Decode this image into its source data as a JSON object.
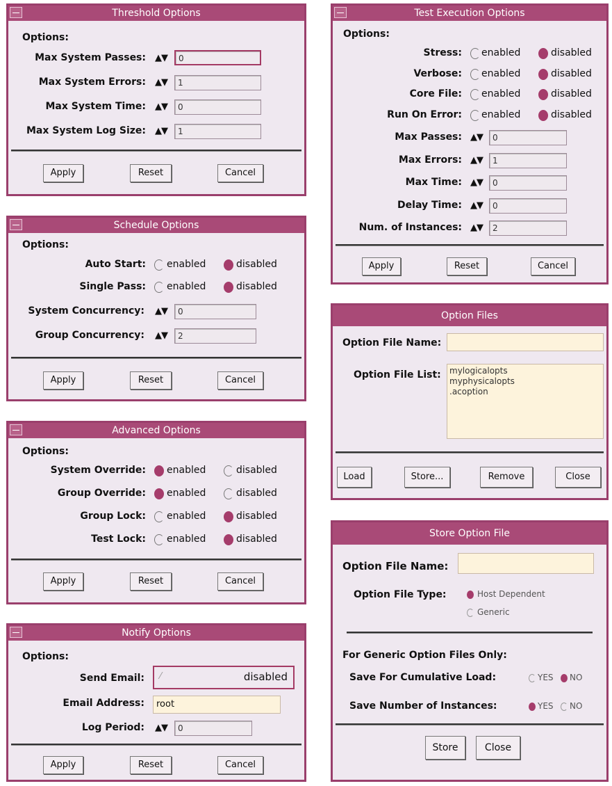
{
  "threshold": {
    "title": "Threshold Options",
    "options_label": "Options:",
    "fields": [
      {
        "label": "Max System Passes:",
        "value": "0"
      },
      {
        "label": "Max System Errors:",
        "value": "1"
      },
      {
        "label": "Max System Time:",
        "value": "0"
      },
      {
        "label": "Max System Log Size:",
        "value": "1"
      }
    ],
    "buttons": {
      "apply": "Apply",
      "reset": "Reset",
      "cancel": "Cancel"
    }
  },
  "schedule": {
    "title": "Schedule Options",
    "options_label": "Options:",
    "radios": [
      {
        "label": "Auto Start:",
        "enabled": "enabled",
        "disabled": "disabled",
        "selected": "disabled"
      },
      {
        "label": "Single Pass:",
        "enabled": "enabled",
        "disabled": "disabled",
        "selected": "disabled"
      }
    ],
    "fields": [
      {
        "label": "System Concurrency:",
        "value": "0"
      },
      {
        "label": "Group Concurrency:",
        "value": "2"
      }
    ],
    "buttons": {
      "apply": "Apply",
      "reset": "Reset",
      "cancel": "Cancel"
    }
  },
  "advanced": {
    "title": "Advanced Options",
    "options_label": "Options:",
    "radios": [
      {
        "label": "System Override:",
        "enabled": "enabled",
        "disabled": "disabled",
        "selected": "enabled"
      },
      {
        "label": "Group Override:",
        "enabled": "enabled",
        "disabled": "disabled",
        "selected": "enabled"
      },
      {
        "label": "Group Lock:",
        "enabled": "enabled",
        "disabled": "disabled",
        "selected": "disabled"
      },
      {
        "label": "Test Lock:",
        "enabled": "enabled",
        "disabled": "disabled",
        "selected": "disabled"
      }
    ],
    "buttons": {
      "apply": "Apply",
      "reset": "Reset",
      "cancel": "Cancel"
    }
  },
  "notify": {
    "title": "Notify Options",
    "options_label": "Options:",
    "send_email_label": "Send Email:",
    "send_email_value": "disabled",
    "email_label": "Email Address:",
    "email_value": "root",
    "log_period_label": "Log Period:",
    "log_period_value": "0",
    "buttons": {
      "apply": "Apply",
      "reset": "Reset",
      "cancel": "Cancel"
    }
  },
  "test_exec": {
    "title": "Test Execution Options",
    "options_label": "Options:",
    "radios": [
      {
        "label": "Stress:",
        "enabled": "enabled",
        "disabled": "disabled",
        "selected": "disabled"
      },
      {
        "label": "Verbose:",
        "enabled": "enabled",
        "disabled": "disabled",
        "selected": "disabled"
      },
      {
        "label": "Core File:",
        "enabled": "enabled",
        "disabled": "disabled",
        "selected": "disabled"
      },
      {
        "label": "Run On Error:",
        "enabled": "enabled",
        "disabled": "disabled",
        "selected": "disabled"
      }
    ],
    "fields": [
      {
        "label": "Max Passes:",
        "value": "0"
      },
      {
        "label": "Max Errors:",
        "value": "1"
      },
      {
        "label": "Max Time:",
        "value": "0"
      },
      {
        "label": "Delay Time:",
        "value": "0"
      },
      {
        "label": "Num. of Instances:",
        "value": "2"
      }
    ],
    "buttons": {
      "apply": "Apply",
      "reset": "Reset",
      "cancel": "Cancel"
    }
  },
  "option_files": {
    "title": "Option Files",
    "name_label": "Option File Name:",
    "name_value": "",
    "list_label": "Option File List:",
    "list_items": [
      "mylogicalopts",
      "myphysicalopts",
      ".acoption"
    ],
    "buttons": {
      "load": "Load",
      "store": "Store...",
      "remove": "Remove",
      "close": "Close"
    }
  },
  "store_file": {
    "title": "Store Option File",
    "name_label": "Option File Name:",
    "name_value": "",
    "type_label": "Option File Type:",
    "type_options": [
      "Host Dependent",
      "Generic"
    ],
    "type_selected": "Host Dependent",
    "generic_heading": "For Generic Option Files Only:",
    "cumulative_label": "Save For Cumulative Load:",
    "cumulative_selected": "NO",
    "instances_label": "Save Number of Instances:",
    "instances_selected": "YES",
    "yes": "YES",
    "no": "NO",
    "buttons": {
      "store": "Store",
      "close": "Close"
    }
  },
  "colors": {
    "titlebar": "#a94a77",
    "border": "#9a3f6c",
    "window_bg": "#efe8f0",
    "radio_on": "#a53c6b",
    "field_bg": "#fdf3dc"
  },
  "icons": {
    "spinner": "up-down-arrows-icon",
    "window_menu": "window-menu-icon"
  },
  "glyphs": {
    "spinner": "▲▼"
  }
}
